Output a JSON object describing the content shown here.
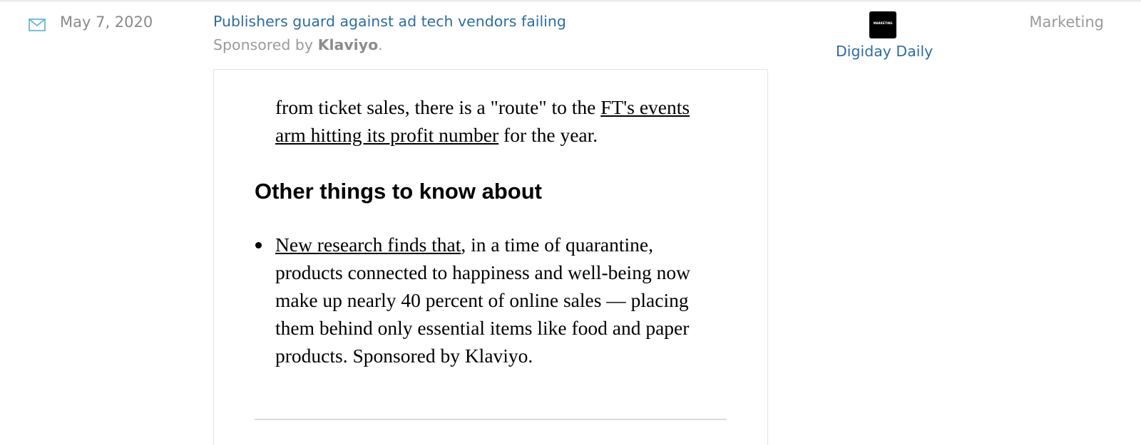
{
  "email_row": {
    "date": "May 7, 2020",
    "headline": "Publishers guard against ad tech vendors failing",
    "sponsor_prefix": "Sponsored by ",
    "sponsor_name": "Klaviyo",
    "sponsor_suffix": ".",
    "publisher": {
      "logo_text": "MARKETING",
      "name": "Digiday Daily"
    },
    "category": "Marketing",
    "icon": "envelope-icon"
  },
  "preview": {
    "paragraph": {
      "text_before": "from ticket sales, there is a \"route\" to the ",
      "link": "FT's events arm hitting its profit number",
      "text_after": " for the year."
    },
    "section_heading": "Other things to know about",
    "bullet": {
      "link": "New research finds that",
      "text_after": ", in a time of quarantine, products connected to happiness and well-being now make up nearly 40 percent of online sales — placing them behind only essential items like food and paper products. Sponsored by Klaviyo."
    }
  },
  "colors": {
    "link_blue": "#2d6da1",
    "muted_gray": "#8a8a8a",
    "icon_blue": "#5aaed6"
  }
}
